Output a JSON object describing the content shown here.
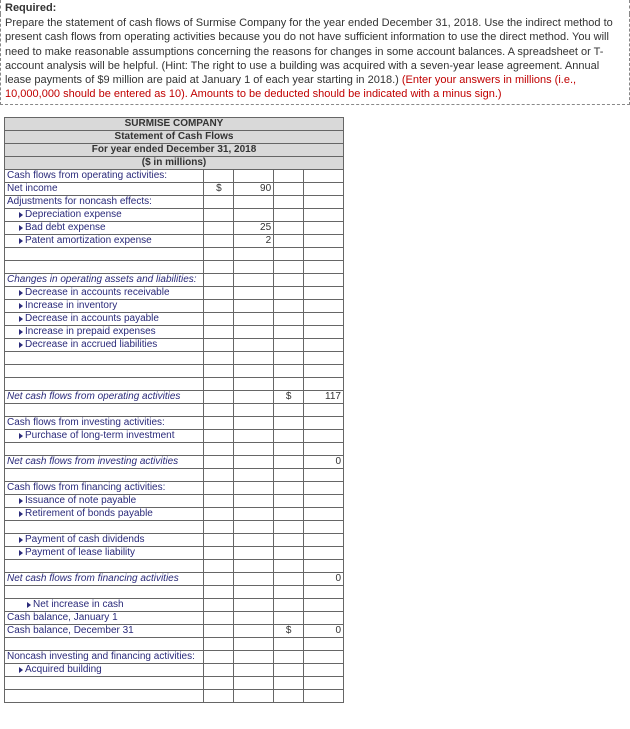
{
  "required_label": "Required:",
  "prompt_text": "Prepare the statement of cash flows of Surmise Company for the year ended December 31, 2018. Use the indirect method to present cash flows from operating activities because you do not have sufficient information to use the direct method. You will need to make reasonable assumptions concerning the reasons for changes in some account balances. A spreadsheet or T-account analysis will be helpful. (Hint: The right to use a building was acquired with a seven-year lease agreement. Annual lease payments of $9 million are paid at January 1 of each year starting in 2018.) ",
  "prompt_red": "(Enter your answers in millions (i.e., 10,000,000 should be entered as 10). Amounts to be deducted should be indicated with a minus sign.)",
  "header": {
    "company": "SURMISE COMPANY",
    "title": "Statement of Cash Flows",
    "period": "For year ended December 31, 2018",
    "units": "($ in millions)"
  },
  "rows": [
    {
      "label": "Cash flows from operating activities:"
    },
    {
      "label": "Net income",
      "sym": "$",
      "val": "90"
    },
    {
      "label": "Adjustments for noncash effects:"
    },
    {
      "label": "Depreciation expense",
      "indent": 1,
      "tri": 1
    },
    {
      "label": "Bad debt expense",
      "indent": 1,
      "tri": 1,
      "val": "25"
    },
    {
      "label": "Patent amortization expense",
      "indent": 1,
      "tri": 1,
      "val": "2"
    },
    {
      "blank": 1
    },
    {
      "blank": 1
    },
    {
      "label": "Changes in operating assets and liabilities:",
      "em": 1
    },
    {
      "label": "Decrease in accounts receivable",
      "indent": 1,
      "tri": 1
    },
    {
      "label": "Increase in inventory",
      "indent": 1,
      "tri": 1
    },
    {
      "label": "Decrease in accounts payable",
      "indent": 1,
      "tri": 1
    },
    {
      "label": "Increase in prepaid expenses",
      "indent": 1,
      "tri": 1
    },
    {
      "label": "Decrease in accrued liabilities",
      "indent": 1,
      "tri": 1
    },
    {
      "blank": 1
    },
    {
      "blank": 1
    },
    {
      "blank": 1
    },
    {
      "label": "Net cash flows from operating activities",
      "em": 1,
      "sym2": "$",
      "val2": "117"
    },
    {
      "blank": 1
    },
    {
      "label": "Cash flows from investing activities:"
    },
    {
      "label": "Purchase of long-term investment",
      "indent": 1,
      "tri": 1
    },
    {
      "blank": 1
    },
    {
      "label": "Net cash flows from investing activities",
      "em": 1,
      "val2": "0"
    },
    {
      "blank": 1
    },
    {
      "label": "Cash flows from financing activities:"
    },
    {
      "label": "Issuance of note payable",
      "indent": 1,
      "tri": 1
    },
    {
      "label": "Retirement of bonds payable",
      "indent": 1,
      "tri": 1
    },
    {
      "blank": 1
    },
    {
      "label": "Payment of cash dividends",
      "indent": 1,
      "tri": 1
    },
    {
      "label": "Payment of lease liability",
      "indent": 1,
      "tri": 1
    },
    {
      "blank": 1
    },
    {
      "label": "Net cash flows from financing activities",
      "em": 1,
      "val2": "0"
    },
    {
      "blank": 1
    },
    {
      "label": "Net increase in cash",
      "indent": 2,
      "tri": 1
    },
    {
      "label": "Cash balance, January 1"
    },
    {
      "label": "Cash balance, December 31",
      "sym2": "$",
      "val2": "0"
    },
    {
      "blank": 1
    },
    {
      "label": "Noncash investing and financing activities:"
    },
    {
      "label": "Acquired building",
      "indent": 1,
      "tri": 1
    },
    {
      "blank": 1
    },
    {
      "blank": 1
    }
  ]
}
